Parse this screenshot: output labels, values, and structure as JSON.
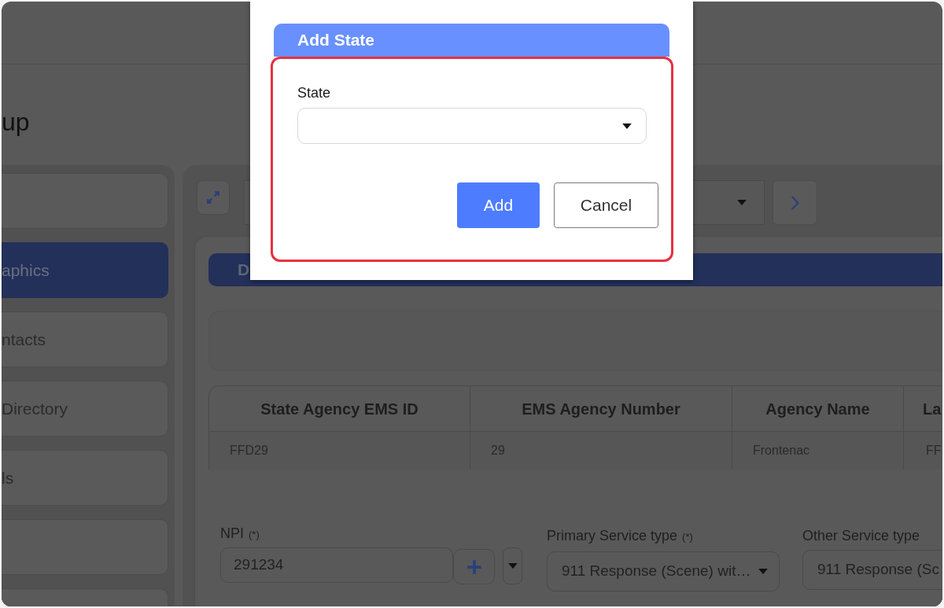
{
  "page": {
    "title": "up"
  },
  "sidebar": {
    "items": [
      {
        "selected": false
      },
      {
        "label": "aphics",
        "selected": true
      },
      {
        "label": "ntacts",
        "selected": false
      },
      {
        "label": "Directory",
        "selected": false
      },
      {
        "label": "ls",
        "selected": false
      },
      {
        "selected": false
      },
      {
        "selected": false
      }
    ]
  },
  "section": {
    "title": "D"
  },
  "table": {
    "columns": [
      "State Agency EMS ID",
      "EMS Agency Number",
      "Agency Name",
      "La"
    ],
    "rows": [
      [
        "FFD29",
        "29",
        "Frontenac",
        "FF"
      ]
    ]
  },
  "form": {
    "fields": [
      {
        "kind": "lookup",
        "label": "NPI",
        "required_mark": "(*)",
        "value": "291234"
      },
      {
        "kind": "select",
        "label": "Primary Service type",
        "required_mark": "(*)",
        "value": "911 Response (Scene) wit…"
      },
      {
        "kind": "select",
        "label": "Other Service type",
        "value": "911 Response (Sc"
      }
    ]
  },
  "dialog": {
    "title": "Add State",
    "field": {
      "label": "State"
    },
    "buttons": [
      {
        "label": "Add",
        "kind": "primary"
      },
      {
        "label": "Cancel",
        "kind": "secondary"
      }
    ]
  }
}
